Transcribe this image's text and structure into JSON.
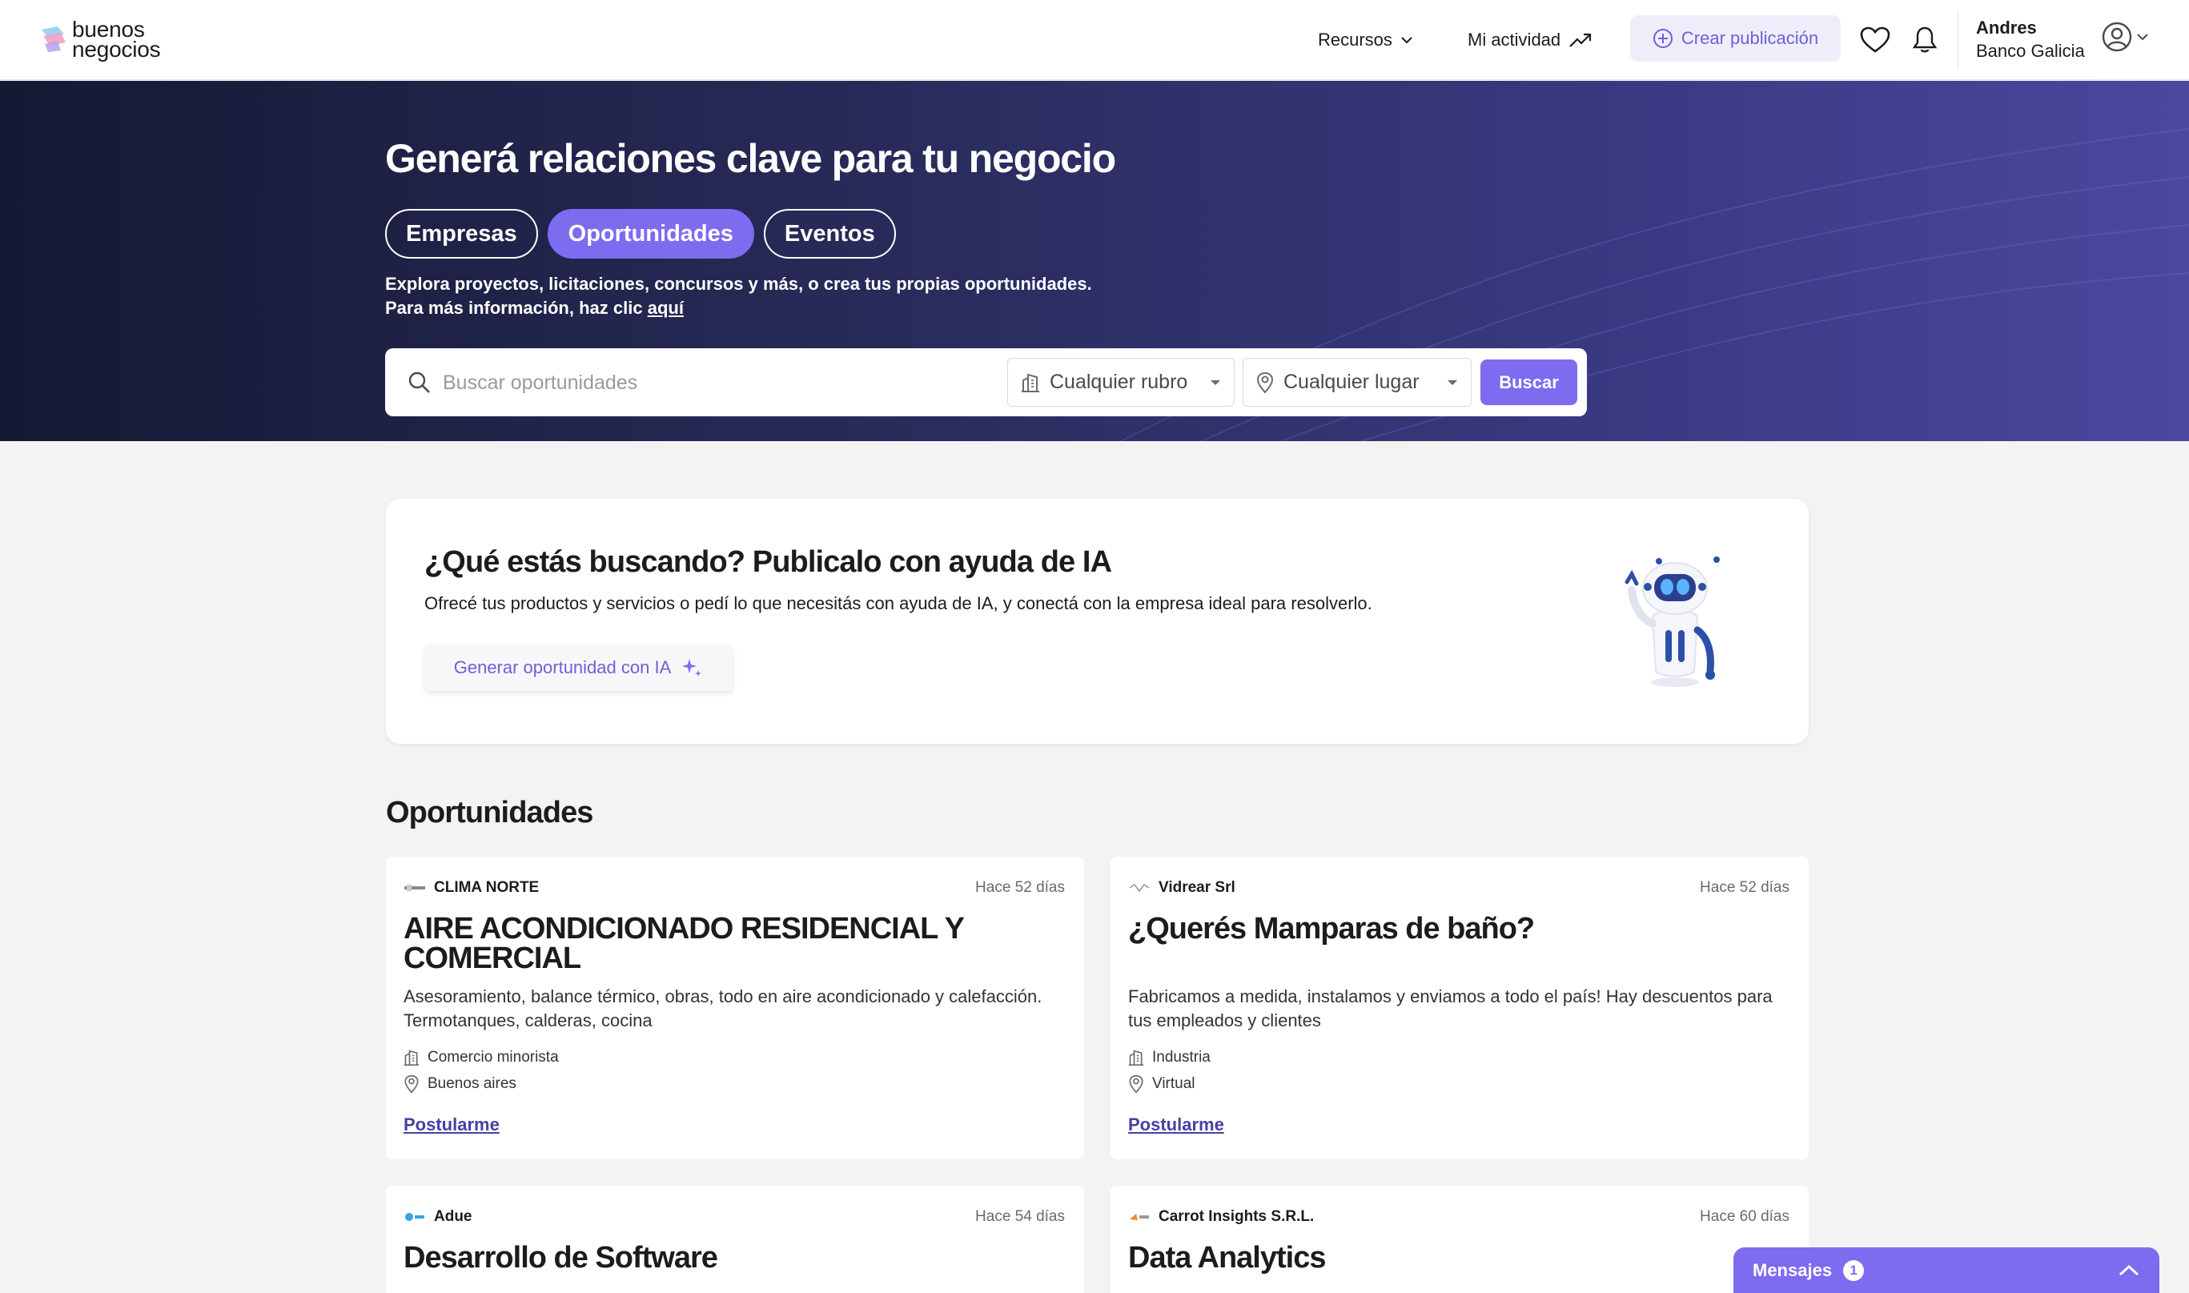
{
  "brand": {
    "logo_line1": "buenos",
    "logo_line2": "negocios",
    "accent": "#7d6cf0"
  },
  "header": {
    "recursos": "Recursos",
    "mi_actividad": "Mi actividad",
    "crear_publicacion": "Crear publicación",
    "user_name": "Andres",
    "user_company": "Banco Galicia",
    "icons": [
      "heart-icon",
      "bell-icon",
      "user-circle-icon"
    ]
  },
  "hero": {
    "title": "Generá relaciones clave para tu negocio",
    "tabs": [
      {
        "label": "Empresas",
        "active": false
      },
      {
        "label": "Oportunidades",
        "active": true
      },
      {
        "label": "Eventos",
        "active": false
      }
    ],
    "desc_line1": "Explora proyectos, licitaciones, concursos y más, o crea tus propias oportunidades.",
    "desc_line2": "Para más información, haz clic",
    "desc_link": "aquí",
    "search": {
      "placeholder": "Buscar oportunidades",
      "rubro": "Cualquier rubro",
      "lugar": "Cualquier lugar",
      "button": "Buscar"
    }
  },
  "ia_card": {
    "title": "¿Qué estás buscando? Publicalo con ayuda de IA",
    "desc": "Ofrecé tus productos y servicios o pedí lo que necesitás con ayuda de IA, y conectá con la empresa ideal para resolverlo.",
    "button": "Generar oportunidad con IA"
  },
  "section_title": "Oportunidades",
  "opportunities": [
    {
      "company": "CLIMA NORTE",
      "time": "Hace 52 días",
      "title": "AIRE ACONDICIONADO RESIDENCIAL Y COMERCIAL",
      "desc": "Asesoramiento, balance térmico, obras, todo en aire acondicionado y calefacción. Termotanques, calderas, cocina",
      "rubro": "Comercio minorista",
      "lugar": "Buenos aires",
      "cta": "Postularme"
    },
    {
      "company": "Vidrear Srl",
      "time": "Hace 52 días",
      "title": "¿Querés Mamparas de baño?",
      "desc": "Fabricamos a medida, instalamos y enviamos a todo el país! Hay descuentos para tus empleados y clientes",
      "rubro": "Industria",
      "lugar": "Virtual",
      "cta": "Postularme"
    },
    {
      "company": "Adue",
      "time": "Hace 54 días",
      "title": "Desarrollo de Software"
    },
    {
      "company": "Carrot Insights S.R.L.",
      "time": "Hace 60 días",
      "title": "Data Analytics"
    }
  ],
  "mensajes": {
    "label": "Mensajes",
    "count": "1"
  }
}
